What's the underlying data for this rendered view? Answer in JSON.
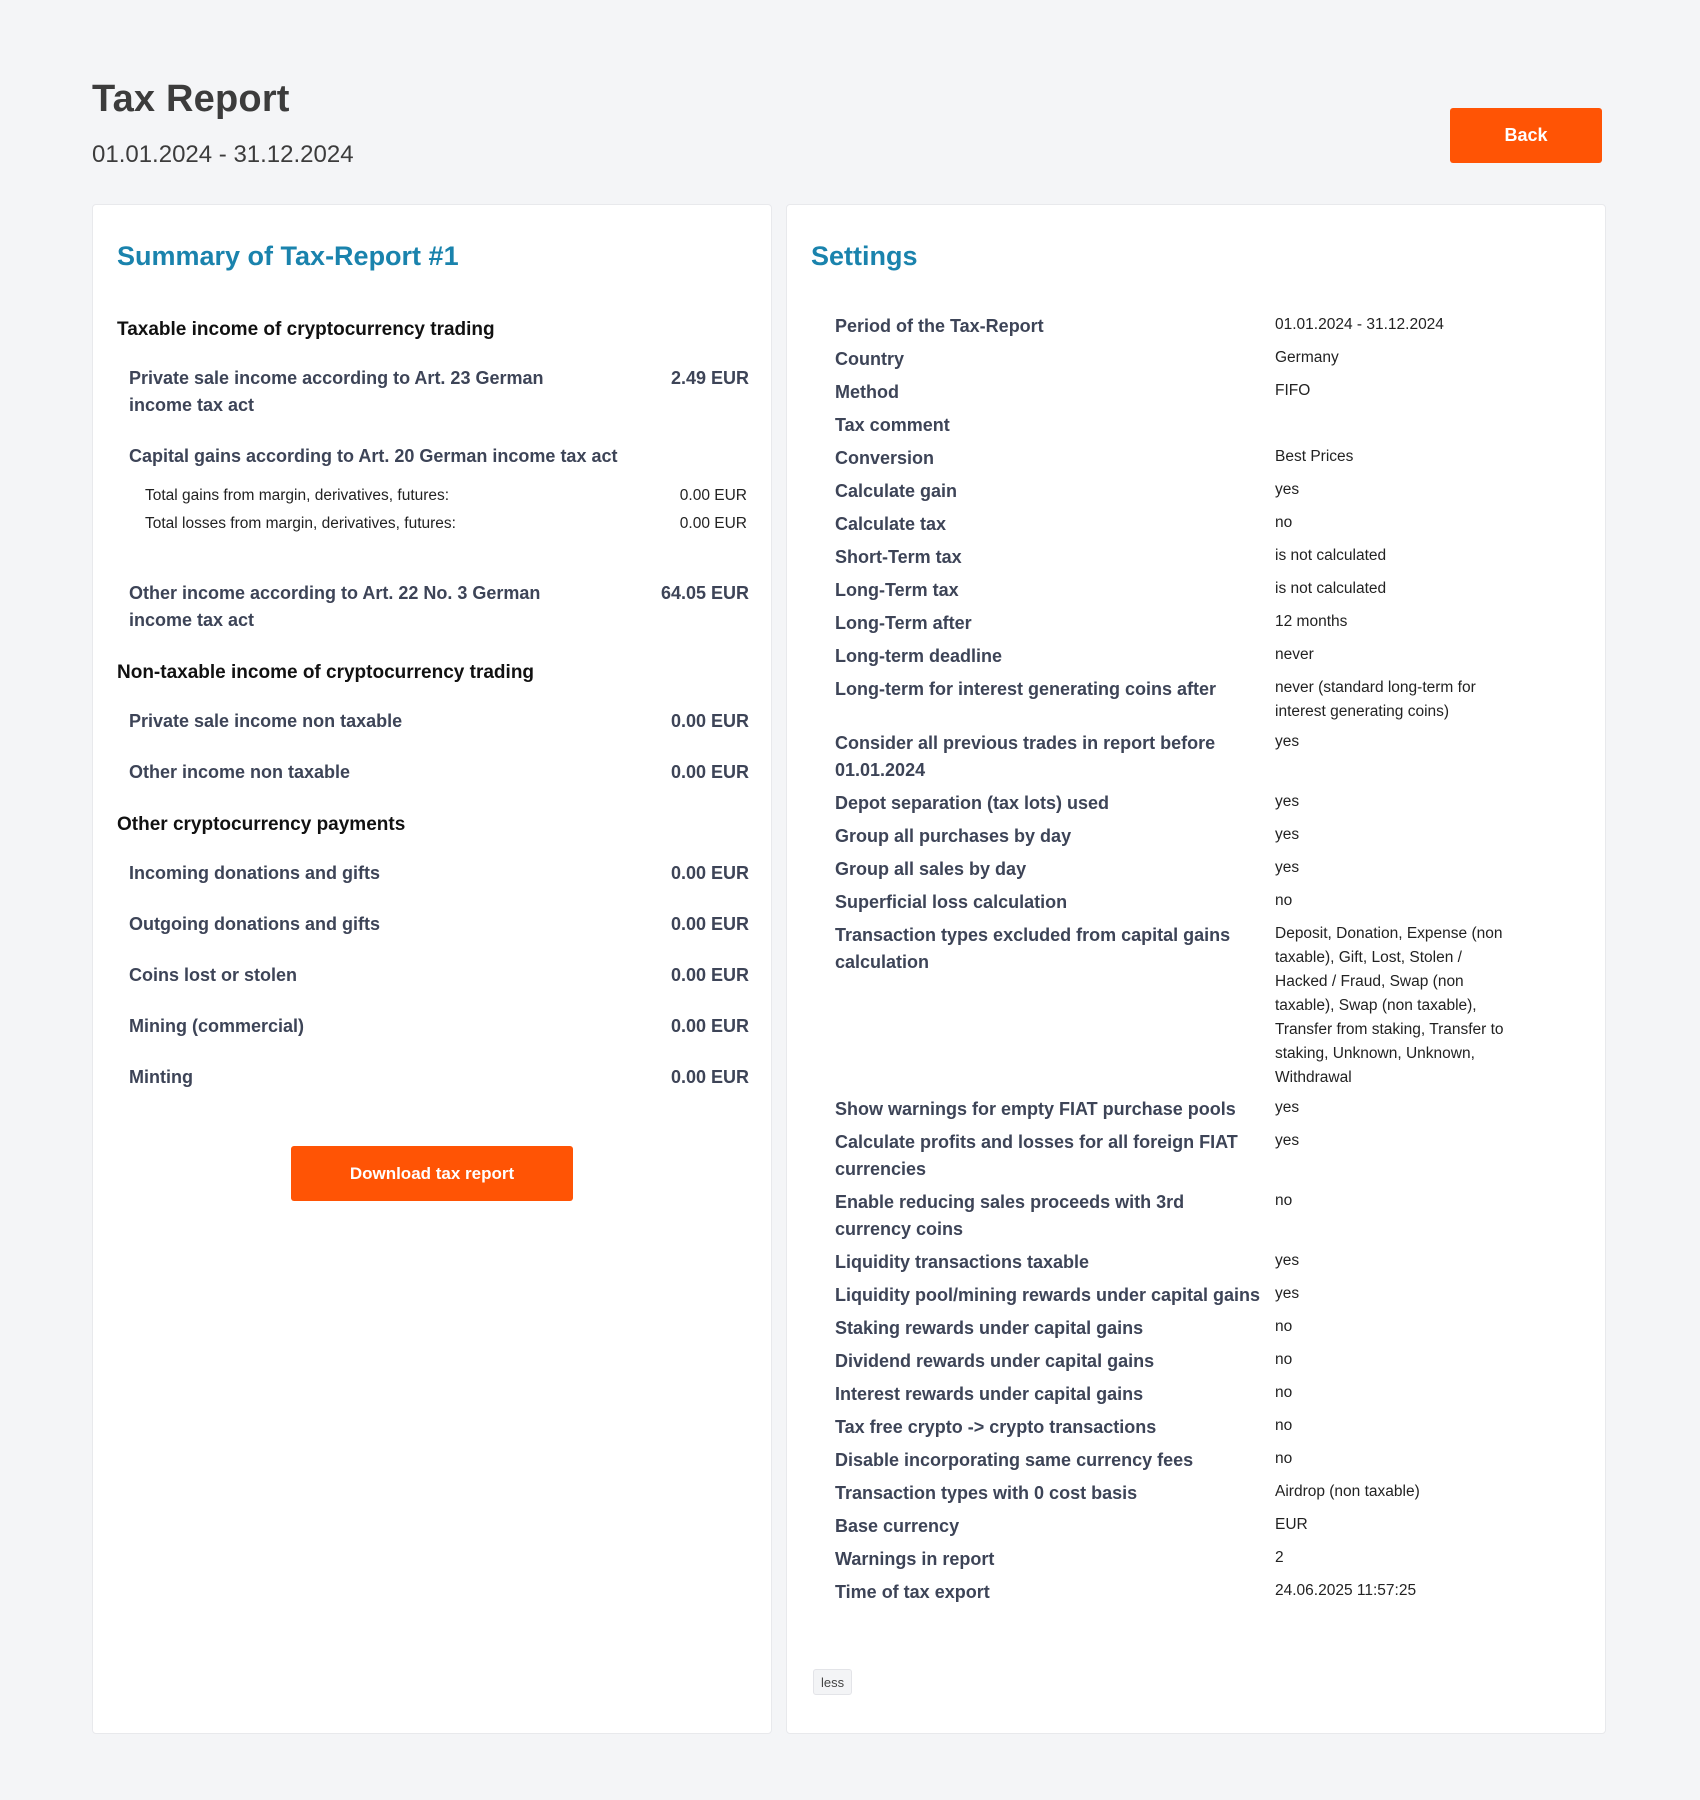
{
  "header": {
    "title": "Tax Report",
    "period": "01.01.2024 - 31.12.2024",
    "back_label": "Back"
  },
  "summary": {
    "title": "Summary of Tax-Report #1",
    "taxable_heading": "Taxable income of cryptocurrency trading",
    "private_sale_label": "Private sale income according to Art. 23 German income tax act",
    "private_sale_value": "2.49 EUR",
    "capital_gains_label": "Capital gains according to Art. 20 German income tax act",
    "total_gains_label": "Total gains from margin, derivatives, futures:",
    "total_gains_value": "0.00 EUR",
    "total_losses_label": "Total losses from margin, derivatives, futures:",
    "total_losses_value": "0.00 EUR",
    "other_income_label": "Other income according to Art. 22 No. 3 German income tax act",
    "other_income_value": "64.05 EUR",
    "nontaxable_heading": "Non-taxable income of cryptocurrency trading",
    "nontaxable_rows": [
      {
        "label": "Private sale income non taxable",
        "value": "0.00 EUR"
      },
      {
        "label": "Other income non taxable",
        "value": "0.00 EUR"
      }
    ],
    "other_payments_heading": "Other cryptocurrency payments",
    "other_payments_rows": [
      {
        "label": "Incoming donations and gifts",
        "value": "0.00 EUR"
      },
      {
        "label": "Outgoing donations and gifts",
        "value": "0.00 EUR"
      },
      {
        "label": "Coins lost or stolen",
        "value": "0.00 EUR"
      },
      {
        "label": "Mining (commercial)",
        "value": "0.00 EUR"
      },
      {
        "label": "Minting",
        "value": "0.00 EUR"
      }
    ],
    "download_label": "Download tax report"
  },
  "settings": {
    "title": "Settings",
    "rows": [
      {
        "key": "Period of the Tax-Report",
        "value": "01.01.2024 - 31.12.2024"
      },
      {
        "key": "Country",
        "value": "Germany"
      },
      {
        "key": "Method",
        "value": "FIFO"
      },
      {
        "key": "Tax comment",
        "value": ""
      },
      {
        "key": "Conversion",
        "value": "Best Prices"
      },
      {
        "key": "Calculate gain",
        "value": "yes"
      },
      {
        "key": "Calculate tax",
        "value": "no"
      },
      {
        "key": "Short-Term tax",
        "value": "is not calculated"
      },
      {
        "key": "Long-Term tax",
        "value": "is not calculated"
      },
      {
        "key": "Long-Term after",
        "value": "12 months"
      },
      {
        "key": "Long-term deadline",
        "value": "never"
      },
      {
        "key": "Long-term for interest generating coins after",
        "value": "never (standard long-term for interest generating coins)"
      },
      {
        "key": "Consider all previous trades in report before 01.01.2024",
        "value": "yes"
      },
      {
        "key": "Depot separation (tax lots) used",
        "value": "yes"
      },
      {
        "key": "Group all purchases by day",
        "value": "yes"
      },
      {
        "key": "Group all sales by day",
        "value": "yes"
      },
      {
        "key": "Superficial loss calculation",
        "value": "no"
      },
      {
        "key": "Transaction types excluded from capital gains calculation",
        "value": "Deposit, Donation, Expense (non taxable), Gift, Lost, Stolen / Hacked / Fraud, Swap (non taxable), Swap (non taxable), Transfer from staking, Transfer to staking, Unknown, Unknown, Withdrawal"
      },
      {
        "key": "Show warnings for empty FIAT purchase pools",
        "value": "yes"
      },
      {
        "key": "Calculate profits and losses for all foreign FIAT currencies",
        "value": "yes"
      },
      {
        "key": "Enable reducing sales proceeds with 3rd currency coins",
        "value": "no"
      },
      {
        "key": "Liquidity transactions taxable",
        "value": "yes"
      },
      {
        "key": "Liquidity pool/mining rewards under capital gains",
        "value": "yes"
      },
      {
        "key": "Staking rewards under capital gains",
        "value": "no"
      },
      {
        "key": "Dividend rewards under capital gains",
        "value": "no"
      },
      {
        "key": "Interest rewards under capital gains",
        "value": "no"
      },
      {
        "key": "Tax free crypto -> crypto transactions",
        "value": "no"
      },
      {
        "key": "Disable incorporating same currency fees",
        "value": "no"
      },
      {
        "key": "Transaction types with 0 cost basis",
        "value": "Airdrop (non taxable)"
      },
      {
        "key": "Base currency",
        "value": "EUR"
      },
      {
        "key": "Warnings in report",
        "value": "2"
      },
      {
        "key": "Time of tax export",
        "value": "24.06.2025 11:57:25"
      }
    ],
    "less_label": "less"
  },
  "colors": {
    "accent": "#ff5405",
    "title_blue": "#1a83ad",
    "label_text": "#3d4457",
    "background": "#f4f5f7"
  }
}
